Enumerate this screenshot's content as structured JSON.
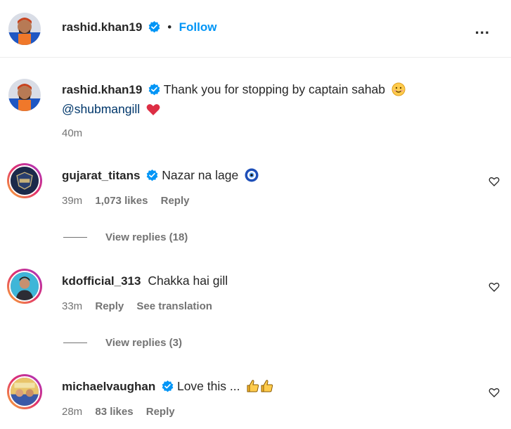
{
  "header": {
    "username": "rashid.khan19",
    "separator": "•",
    "follow_label": "Follow",
    "more_label": "..."
  },
  "caption": {
    "username": "rashid.khan19",
    "text": "Thank you for stopping by captain sahab",
    "mention": "@shubmangill",
    "time": "40m"
  },
  "comments": [
    {
      "username": "gujarat_titans",
      "text": "Nazar na lage",
      "time": "39m",
      "likes": "1,073 likes",
      "reply_label": "Reply",
      "replies_label": "View replies (18)"
    },
    {
      "username": "kdofficial_313",
      "text": "Chakka hai gill",
      "time": "33m",
      "reply_label": "Reply",
      "translation_label": "See translation",
      "replies_label": "View replies (3)"
    },
    {
      "username": "michaelvaughan",
      "text": "Love this ...",
      "time": "28m",
      "likes": "83 likes",
      "reply_label": "Reply"
    }
  ],
  "colors": {
    "accent": "#0095f6",
    "verified": "#0095f6",
    "muted": "#737373",
    "mention": "#00376b",
    "heart_emoji": "#e0245e"
  }
}
